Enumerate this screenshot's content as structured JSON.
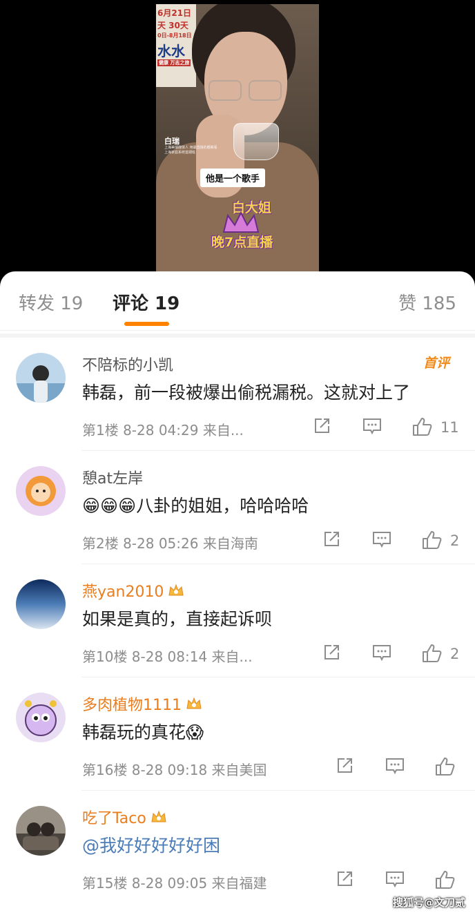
{
  "video": {
    "poster_lines": [
      "6月21日",
      "天  30天",
      "0日-8月18日",
      "水水",
      "健康 万志之旅"
    ],
    "person_name": "白瑞",
    "person_desc": "上海美瑞媒体人 用最直接的眼睛看 上海家庭系统首期班",
    "subtitle": "他是一个歌手",
    "promo_line1": "白大姐",
    "promo_line2": "晚7点直播"
  },
  "tabs": {
    "repost": "转发 19",
    "comments": "评论 19",
    "likes": "赞 185"
  },
  "comments": [
    {
      "user": "不陪标的小凯",
      "vip": false,
      "badge": "首评",
      "text": "韩磊，前一段被爆出偷税漏税。这就对上了",
      "meta": "第1楼  8-28 04:29  来自...",
      "likes": "11"
    },
    {
      "user": "憩at左岸",
      "vip": false,
      "badge": "",
      "text": "八卦的姐姐，哈哈哈哈",
      "emoji_prefix": "😁😁😁",
      "meta": "第2楼  8-28 05:26  来自海南",
      "likes": "2"
    },
    {
      "user": "燕yan2010",
      "vip": true,
      "badge": "",
      "text": "如果是真的，直接起诉呗",
      "meta": "第10楼  8-28 08:14  来自...",
      "likes": "2"
    },
    {
      "user": "多肉植物1111",
      "vip": true,
      "badge": "",
      "text": "韩磊玩的真花",
      "emoji_suffix": "😱",
      "meta": "第16楼  8-28 09:18  来自美国",
      "likes": ""
    },
    {
      "user": "吃了Taco",
      "vip": true,
      "badge": "",
      "text": "@我好好好好好困",
      "meta": "第15楼  8-28 09:05  来自福建",
      "likes": ""
    }
  ],
  "watermark": "搜狐号@文刀贰"
}
